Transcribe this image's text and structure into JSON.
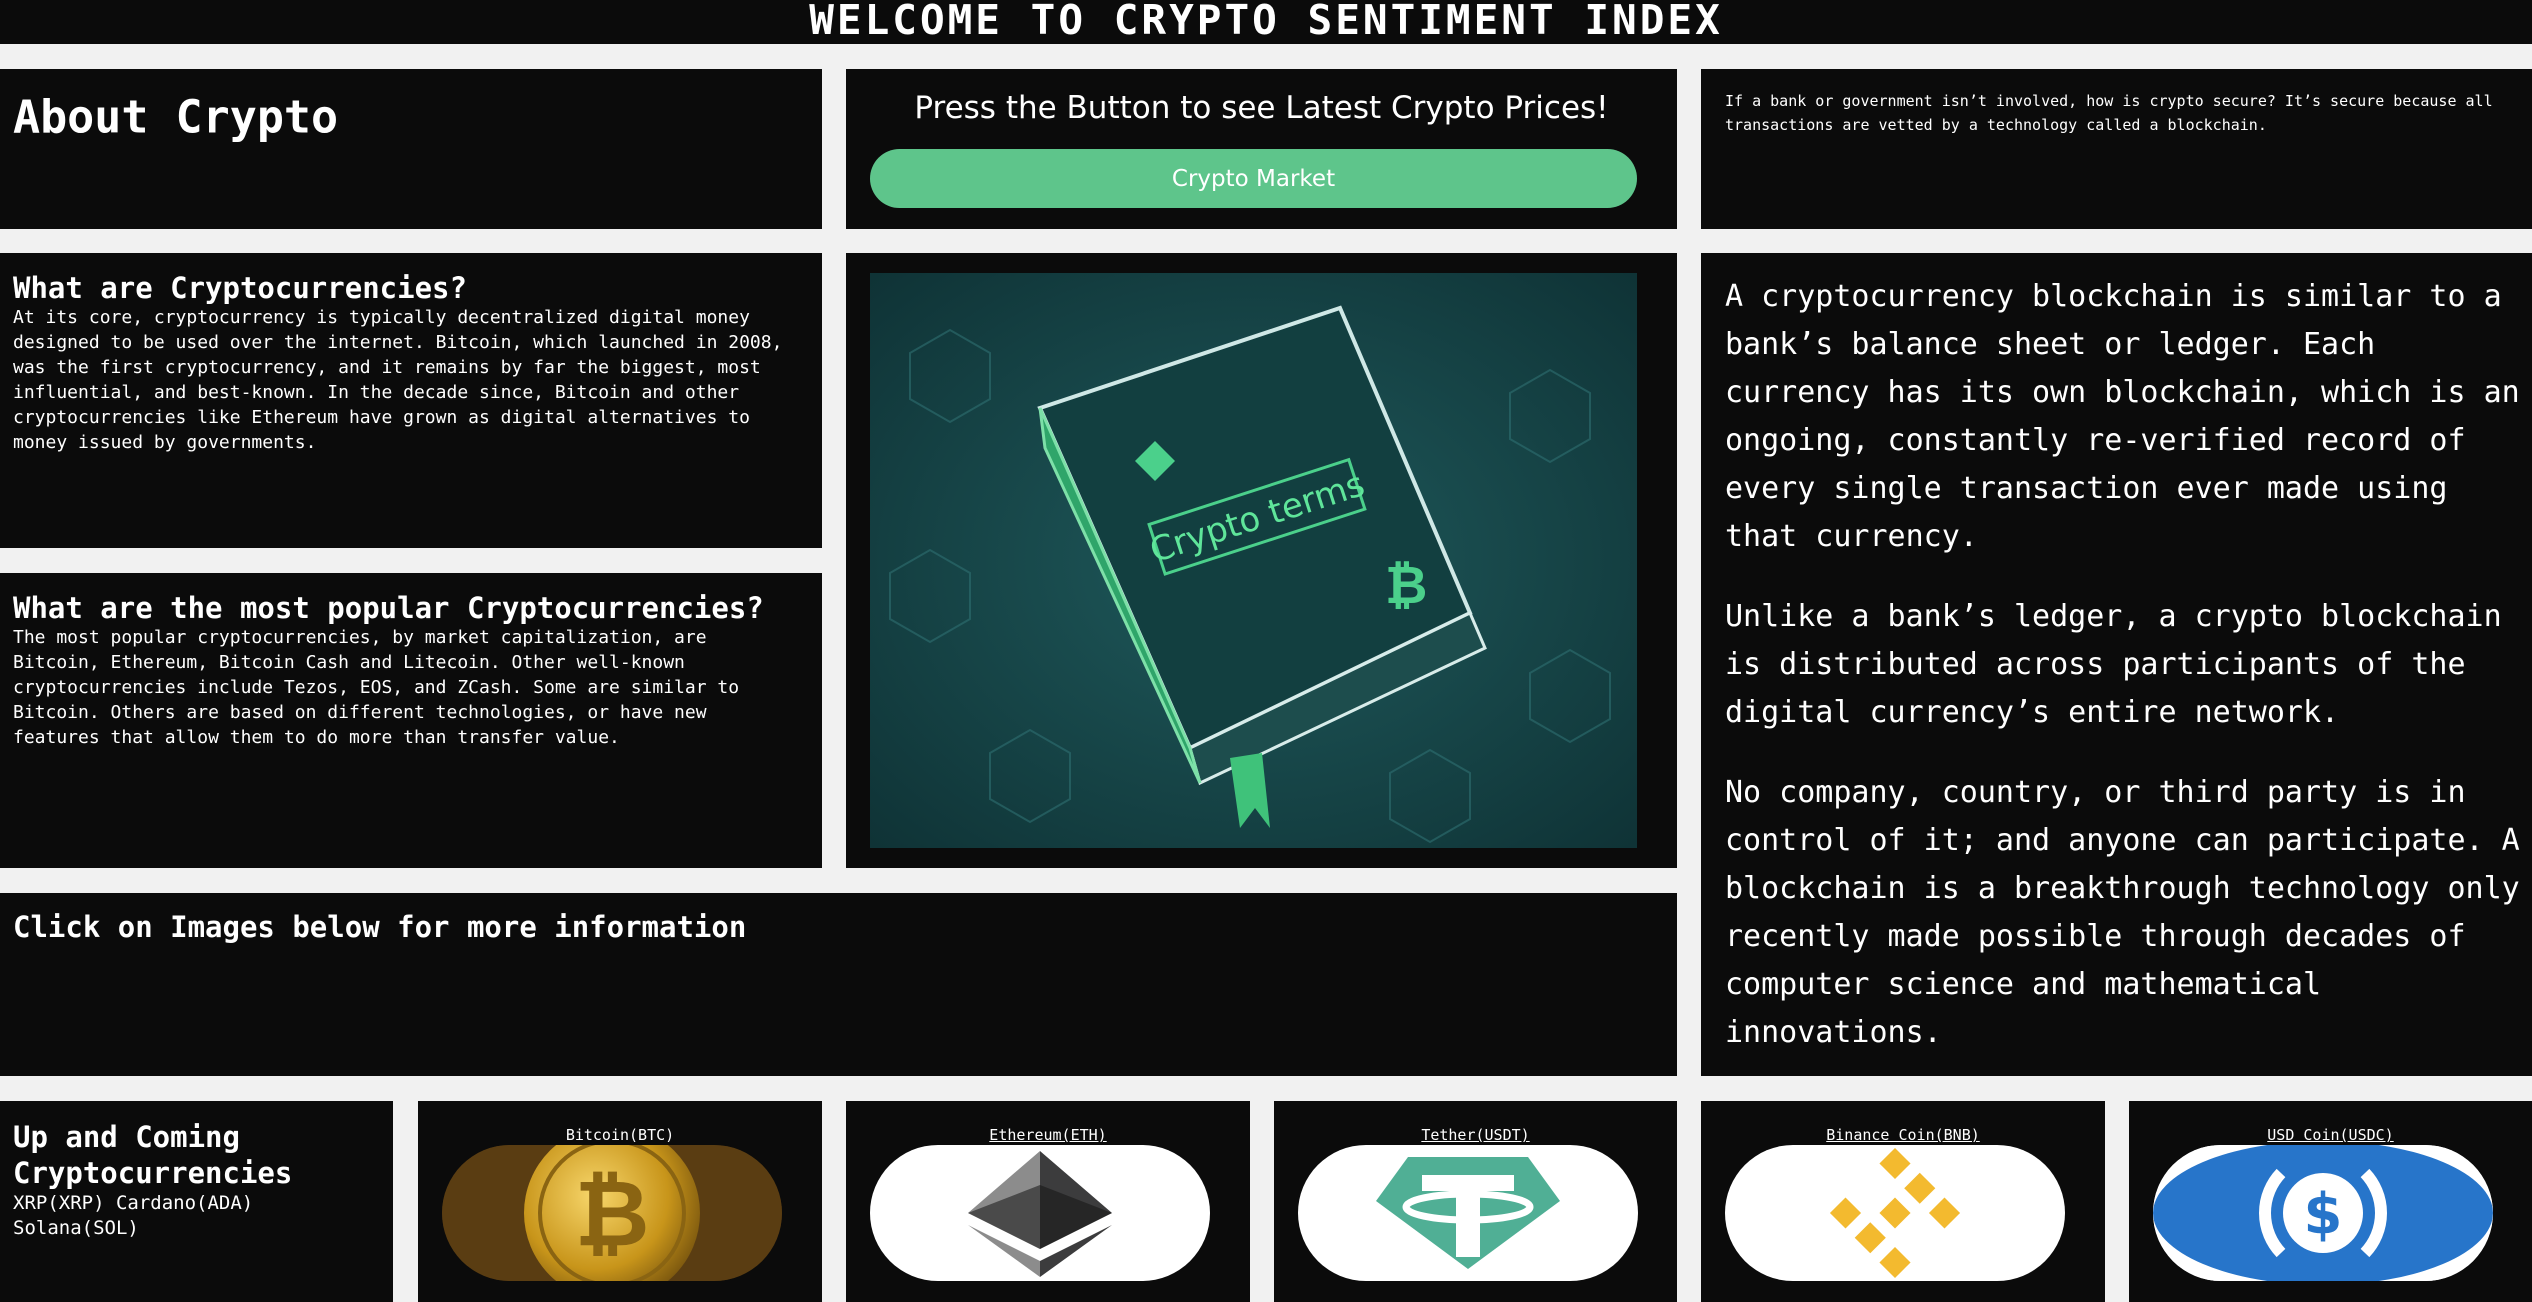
{
  "header": {
    "title": "WELCOME TO CRYPTO SENTIMENT INDEX"
  },
  "about": {
    "title": "About Crypto"
  },
  "market": {
    "prompt": "Press the Button to see Latest Crypto Prices!",
    "button_label": "Crypto Market"
  },
  "security_note": "If a bank or government isn’t involved, how is crypto secure? It’s secure because all transactions are vetted by a technology called a blockchain.",
  "what_are": {
    "title": "What are Cryptocurrencies?",
    "body": "At its core, cryptocurrency is typically decentralized digital money designed to be used over the internet. Bitcoin, which launched in 2008, was the first cryptocurrency, and it remains by far the biggest, most influential, and best-known. In the decade since, Bitcoin and other cryptocurrencies like Ethereum have grown as digital alternatives to money issued by governments."
  },
  "most_popular": {
    "title": "What are the most popular Cryptocurrencies?",
    "body": "The most popular cryptocurrencies, by market capitalization, are Bitcoin, Ethereum, Bitcoin Cash and Litecoin. Other well-known cryptocurrencies include Tezos, EOS, and ZCash. Some are similar to Bitcoin. Others are based on different technologies, or have new features that allow them to do more than transfer value."
  },
  "hero_image": {
    "book_label": "Crypto terms",
    "icon": "crypto-book-illustration"
  },
  "blockchain": {
    "paragraphs": [
      "A cryptocurrency blockchain is similar to a bank’s balance sheet or ledger. Each currency has its own blockchain, which is an ongoing, constantly re-verified record of every single transaction ever made using that currency.",
      "Unlike a bank’s ledger, a crypto blockchain is distributed across participants of the digital currency’s entire network.",
      "No company, country, or third party is in control of it; and anyone can participate. A blockchain is a breakthrough technology only recently made possible through decades of computer science and mathematical innovations."
    ]
  },
  "click_prompt": "Click on Images below for more information",
  "upcoming": {
    "title": "Up and Coming Cryptocurrencies",
    "coins": [
      "XRP(XRP)",
      "Cardano(ADA)",
      "Solana(SOL)"
    ]
  },
  "coins": [
    {
      "label": "Bitcoin(BTC)",
      "icon": "bitcoin-icon",
      "color": "#c8951a"
    },
    {
      "label": "Ethereum(ETH)",
      "icon": "ethereum-icon",
      "color": "#3c3c3d"
    },
    {
      "label": "Tether(USDT)",
      "icon": "tether-icon",
      "color": "#50af95"
    },
    {
      "label": "Binance Coin(BNB)",
      "icon": "binance-icon",
      "color": "#f3ba2f"
    },
    {
      "label": "USD Coin(USDC)",
      "icon": "usdc-icon",
      "color": "#2775ca"
    }
  ],
  "colors": {
    "panel": "#0b0b0b",
    "page": "#f1f1f1",
    "accent": "#5ec58b"
  }
}
